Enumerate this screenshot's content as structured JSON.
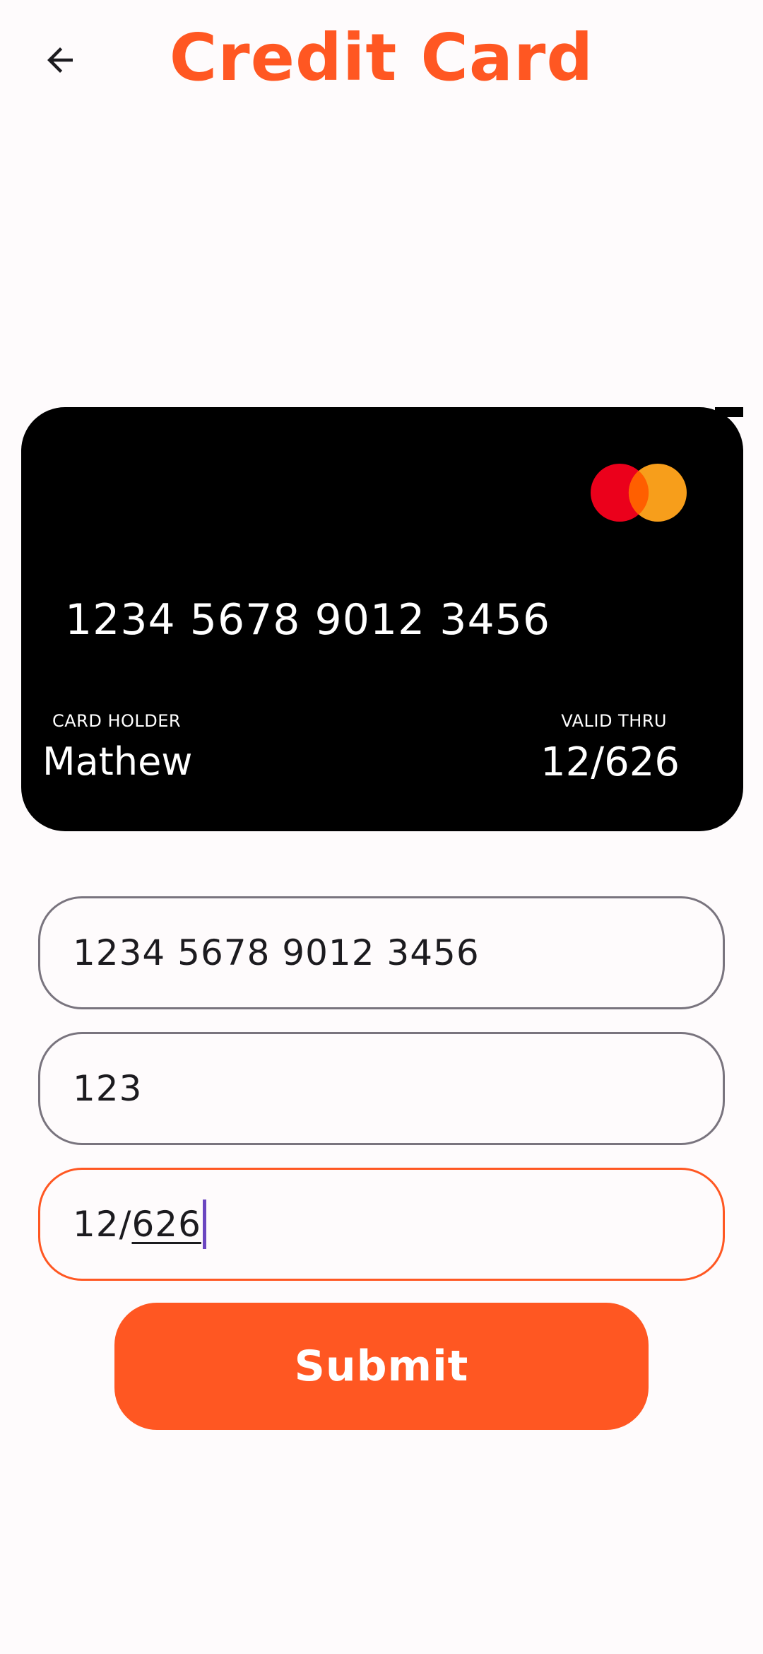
{
  "header": {
    "title": "Credit Card",
    "back_icon": "arrow-back-icon"
  },
  "card": {
    "number": "1234 5678 9012 3456",
    "holder_label": "CARD HOLDER",
    "holder_name": "Mathew",
    "valid_label": "VALID THRU",
    "valid_value": "12/626",
    "brand_icon": "mastercard-icon",
    "background_color": "#000000"
  },
  "form": {
    "card_number_value": "1234 5678 9012 3456",
    "cvv_value": "123",
    "expiry_prefix": "12/",
    "expiry_suffix": "626",
    "submit_label": "Submit"
  },
  "colors": {
    "accent": "#ff5722",
    "field_border": "#79747e",
    "caret": "#6b46c1"
  }
}
